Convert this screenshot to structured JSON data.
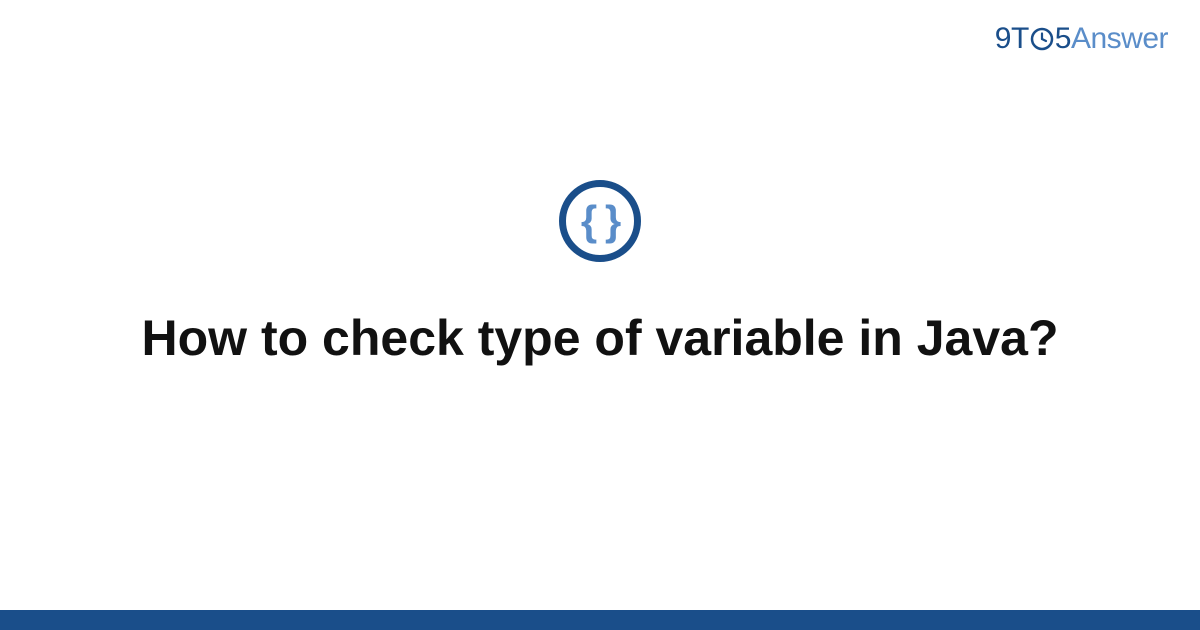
{
  "logo": {
    "nine": "9",
    "t": "T",
    "five": "5",
    "answer": "Answer"
  },
  "icon": {
    "braces": "{ }"
  },
  "title": "How to check type of variable in Java?"
}
